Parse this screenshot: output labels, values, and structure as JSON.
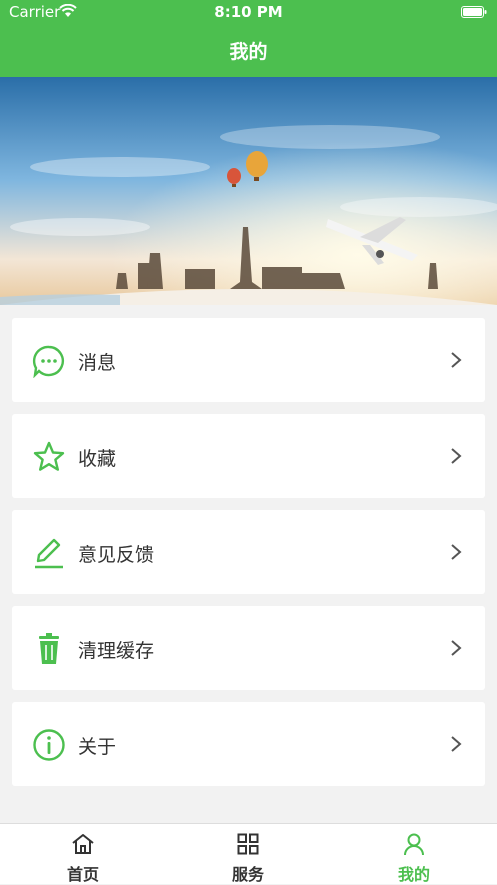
{
  "status_bar": {
    "carrier": "Carrier",
    "time": "8:10 PM"
  },
  "header": {
    "title": "我的"
  },
  "menu": [
    {
      "label": "消息",
      "icon": "message-icon"
    },
    {
      "label": "收藏",
      "icon": "star-icon"
    },
    {
      "label": "意见反馈",
      "icon": "edit-icon"
    },
    {
      "label": "清理缓存",
      "icon": "trash-icon"
    },
    {
      "label": "关于",
      "icon": "info-icon"
    }
  ],
  "tabbar": [
    {
      "label": "首页",
      "icon": "home-icon",
      "active": false
    },
    {
      "label": "服务",
      "icon": "grid-icon",
      "active": false
    },
    {
      "label": "我的",
      "icon": "user-icon",
      "active": true
    }
  ],
  "colors": {
    "accent": "#4cbf4f",
    "background": "#f2f2f2",
    "text": "#333333"
  }
}
